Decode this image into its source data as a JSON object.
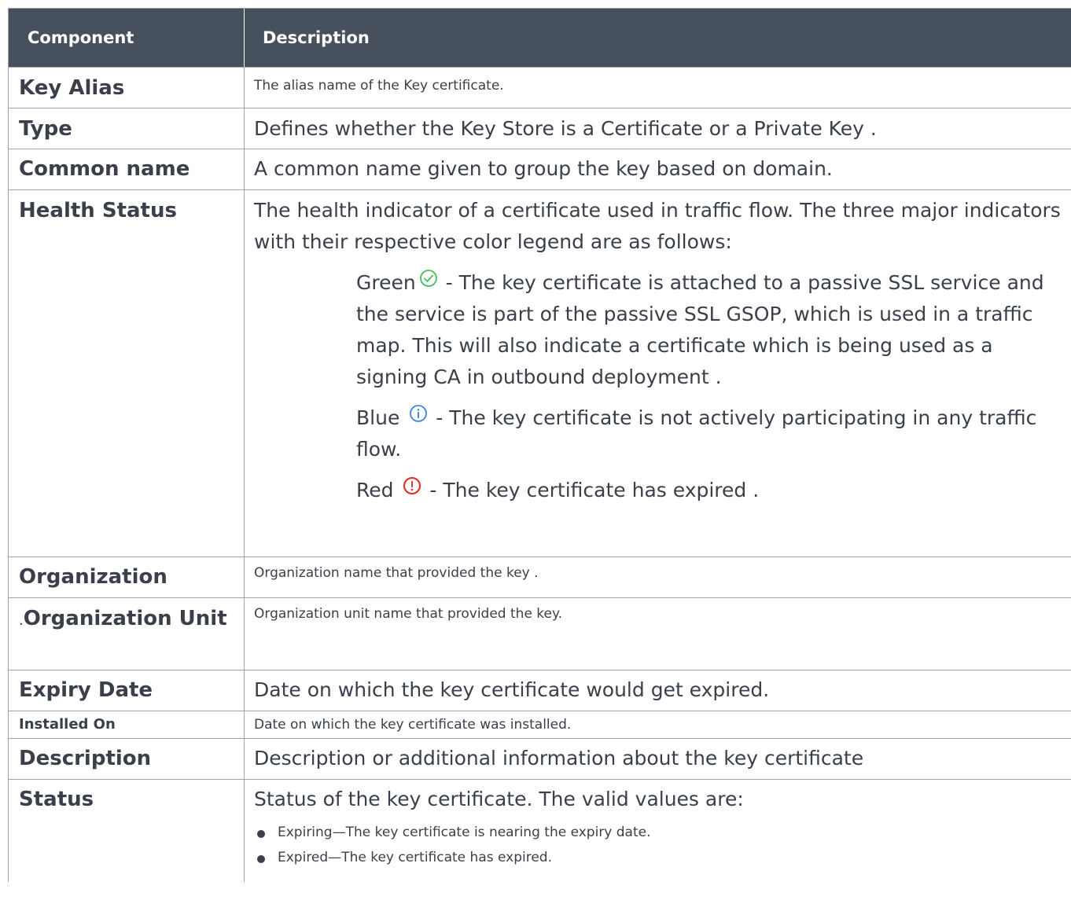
{
  "table": {
    "headers": {
      "component": "Component",
      "description": "Description"
    },
    "rows": {
      "key_alias": {
        "label": "Key Alias",
        "desc": "The alias name of the Key certificate."
      },
      "type": {
        "label": "Type",
        "desc": "Defines whether the Key Store is a Certificate or a Private Key ."
      },
      "common_name": {
        "label": "Common name",
        "desc": "A common name given to group the key based on domain."
      },
      "health_status": {
        "label": "Health Status",
        "desc": "The health indicator of a certificate used in traffic flow. The three major indicators with their respective color legend are as follows:",
        "green_label": "Green",
        "green_text": "- The key certificate is attached to a passive SSL service and the service is part of the passive SSL GSOP, which is used in a traffic map. This will also indicate a certificate which is being used as a signing CA in outbound deployment .",
        "blue_label": "Blue",
        "blue_text": "- The key certificate is not actively participating in any traffic flow.",
        "red_label": "Red",
        "red_text": "- The key certificate has expired ."
      },
      "organization": {
        "label": "Organization",
        "desc": "Organization name that provided the key ."
      },
      "organization_unit": {
        "prefix": ".",
        "label": "Organization Unit",
        "desc": "Organization unit name that provided the key."
      },
      "expiry_date": {
        "label": "Expiry Date",
        "desc": "Date on which the key certificate would get expired."
      },
      "installed_on": {
        "label": "Installed On",
        "desc": "Date on which the key certificate was installed."
      },
      "description": {
        "label": "Description",
        "desc": "Description or additional information about the key certificate"
      },
      "status": {
        "label": "Status",
        "desc": "Status of the key certificate. The valid values are:",
        "bullets": [
          "Expiring—The key certificate is nearing the expiry date.",
          "Expired—The key certificate has expired."
        ]
      }
    }
  },
  "icons": {
    "green": {
      "name": "check-circle-icon",
      "color": "#3ec15b"
    },
    "blue": {
      "name": "info-circle-icon",
      "color": "#3a86e8"
    },
    "red": {
      "name": "alert-circle-icon",
      "color": "#e0362c"
    }
  },
  "colors": {
    "header_bg": "#47515e",
    "text": "#3a3f4a",
    "border": "#9aa2ad"
  }
}
